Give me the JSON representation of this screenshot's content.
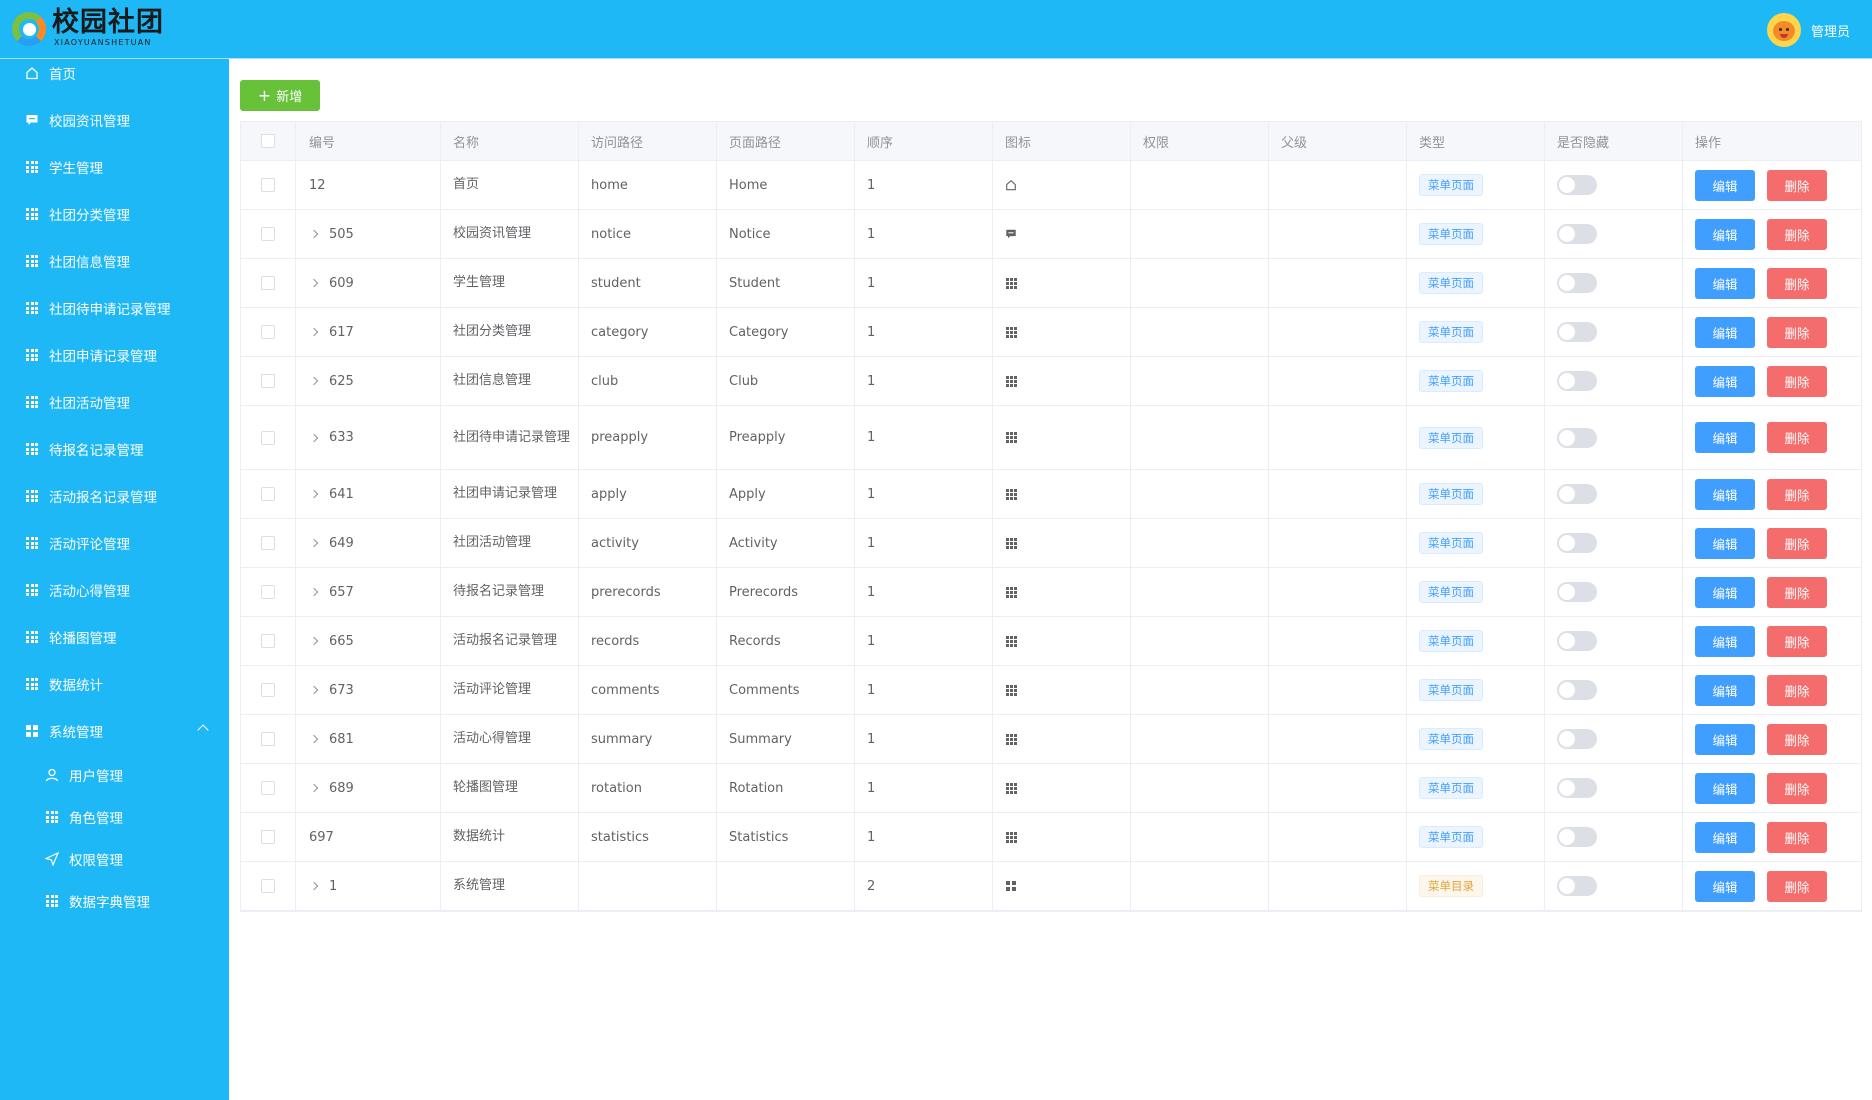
{
  "header": {
    "logo_title": "校园社团",
    "logo_sub": "XIAOYUANSHETUAN",
    "user_name": "管理员"
  },
  "sidebar": {
    "items": [
      {
        "label": "首页",
        "icon": "home-icon"
      },
      {
        "label": "校园资讯管理",
        "icon": "message-icon"
      },
      {
        "label": "学生管理",
        "icon": "grid-icon"
      },
      {
        "label": "社团分类管理",
        "icon": "grid-icon"
      },
      {
        "label": "社团信息管理",
        "icon": "grid-icon"
      },
      {
        "label": "社团待申请记录管理",
        "icon": "grid-icon"
      },
      {
        "label": "社团申请记录管理",
        "icon": "grid-icon"
      },
      {
        "label": "社团活动管理",
        "icon": "grid-icon"
      },
      {
        "label": "待报名记录管理",
        "icon": "grid-icon"
      },
      {
        "label": "活动报名记录管理",
        "icon": "grid-icon"
      },
      {
        "label": "活动评论管理",
        "icon": "grid-icon"
      },
      {
        "label": "活动心得管理",
        "icon": "grid-icon"
      },
      {
        "label": "轮播图管理",
        "icon": "grid-icon"
      },
      {
        "label": "数据统计",
        "icon": "grid-icon"
      },
      {
        "label": "系统管理",
        "icon": "menu-icon"
      },
      {
        "label": "用户管理",
        "icon": "user-icon"
      },
      {
        "label": "角色管理",
        "icon": "grid-icon"
      },
      {
        "label": "权限管理",
        "icon": "send-icon"
      },
      {
        "label": "数据字典管理",
        "icon": "grid-icon"
      }
    ]
  },
  "toolbar": {
    "add_label": "新增"
  },
  "table": {
    "headers": [
      "编号",
      "名称",
      "访问路径",
      "页面路径",
      "顺序",
      "图标",
      "权限",
      "父级",
      "类型",
      "是否隐藏",
      "操作"
    ],
    "edit_label": "编辑",
    "delete_label": "删除",
    "rows": [
      {
        "id": "12",
        "name": "首页",
        "path": "home",
        "page": "Home",
        "order": "1",
        "icon": "home-icon",
        "perm": "",
        "parent": "",
        "type": "菜单页面"
      },
      {
        "id": "505",
        "name": "校园资讯管理",
        "path": "notice",
        "page": "Notice",
        "order": "1",
        "icon": "message-icon",
        "perm": "",
        "parent": "",
        "type": "菜单页面"
      },
      {
        "id": "609",
        "name": "学生管理",
        "path": "student",
        "page": "Student",
        "order": "1",
        "icon": "grid-icon",
        "perm": "",
        "parent": "",
        "type": "菜单页面"
      },
      {
        "id": "617",
        "name": "社团分类管理",
        "path": "category",
        "page": "Category",
        "order": "1",
        "icon": "grid-icon",
        "perm": "",
        "parent": "",
        "type": "菜单页面"
      },
      {
        "id": "625",
        "name": "社团信息管理",
        "path": "club",
        "page": "Club",
        "order": "1",
        "icon": "grid-icon",
        "perm": "",
        "parent": "",
        "type": "菜单页面"
      },
      {
        "id": "633",
        "name": "社团待申请记录管理",
        "path": "preapply",
        "page": "Preapply",
        "order": "1",
        "icon": "grid-icon",
        "perm": "",
        "parent": "",
        "type": "菜单页面"
      },
      {
        "id": "641",
        "name": "社团申请记录管理",
        "path": "apply",
        "page": "Apply",
        "order": "1",
        "icon": "grid-icon",
        "perm": "",
        "parent": "",
        "type": "菜单页面"
      },
      {
        "id": "649",
        "name": "社团活动管理",
        "path": "activity",
        "page": "Activity",
        "order": "1",
        "icon": "grid-icon",
        "perm": "",
        "parent": "",
        "type": "菜单页面"
      },
      {
        "id": "657",
        "name": "待报名记录管理",
        "path": "prerecords",
        "page": "Prerecords",
        "order": "1",
        "icon": "grid-icon",
        "perm": "",
        "parent": "",
        "type": "菜单页面"
      },
      {
        "id": "665",
        "name": "活动报名记录管理",
        "path": "records",
        "page": "Records",
        "order": "1",
        "icon": "grid-icon",
        "perm": "",
        "parent": "",
        "type": "菜单页面"
      },
      {
        "id": "673",
        "name": "活动评论管理",
        "path": "comments",
        "page": "Comments",
        "order": "1",
        "icon": "grid-icon",
        "perm": "",
        "parent": "",
        "type": "菜单页面"
      },
      {
        "id": "681",
        "name": "活动心得管理",
        "path": "summary",
        "page": "Summary",
        "order": "1",
        "icon": "grid-icon",
        "perm": "",
        "parent": "",
        "type": "菜单页面"
      },
      {
        "id": "689",
        "name": "轮播图管理",
        "path": "rotation",
        "page": "Rotation",
        "order": "1",
        "icon": "grid-icon",
        "perm": "",
        "parent": "",
        "type": "菜单页面"
      },
      {
        "id": "697",
        "name": "数据统计",
        "path": "statistics",
        "page": "Statistics",
        "order": "1",
        "icon": "grid-icon",
        "perm": "",
        "parent": "",
        "type": "菜单页面"
      },
      {
        "id": "1",
        "name": "系统管理",
        "path": "",
        "page": "",
        "order": "2",
        "icon": "menu-icon",
        "perm": "",
        "parent": "",
        "type": "菜单目录"
      }
    ]
  }
}
